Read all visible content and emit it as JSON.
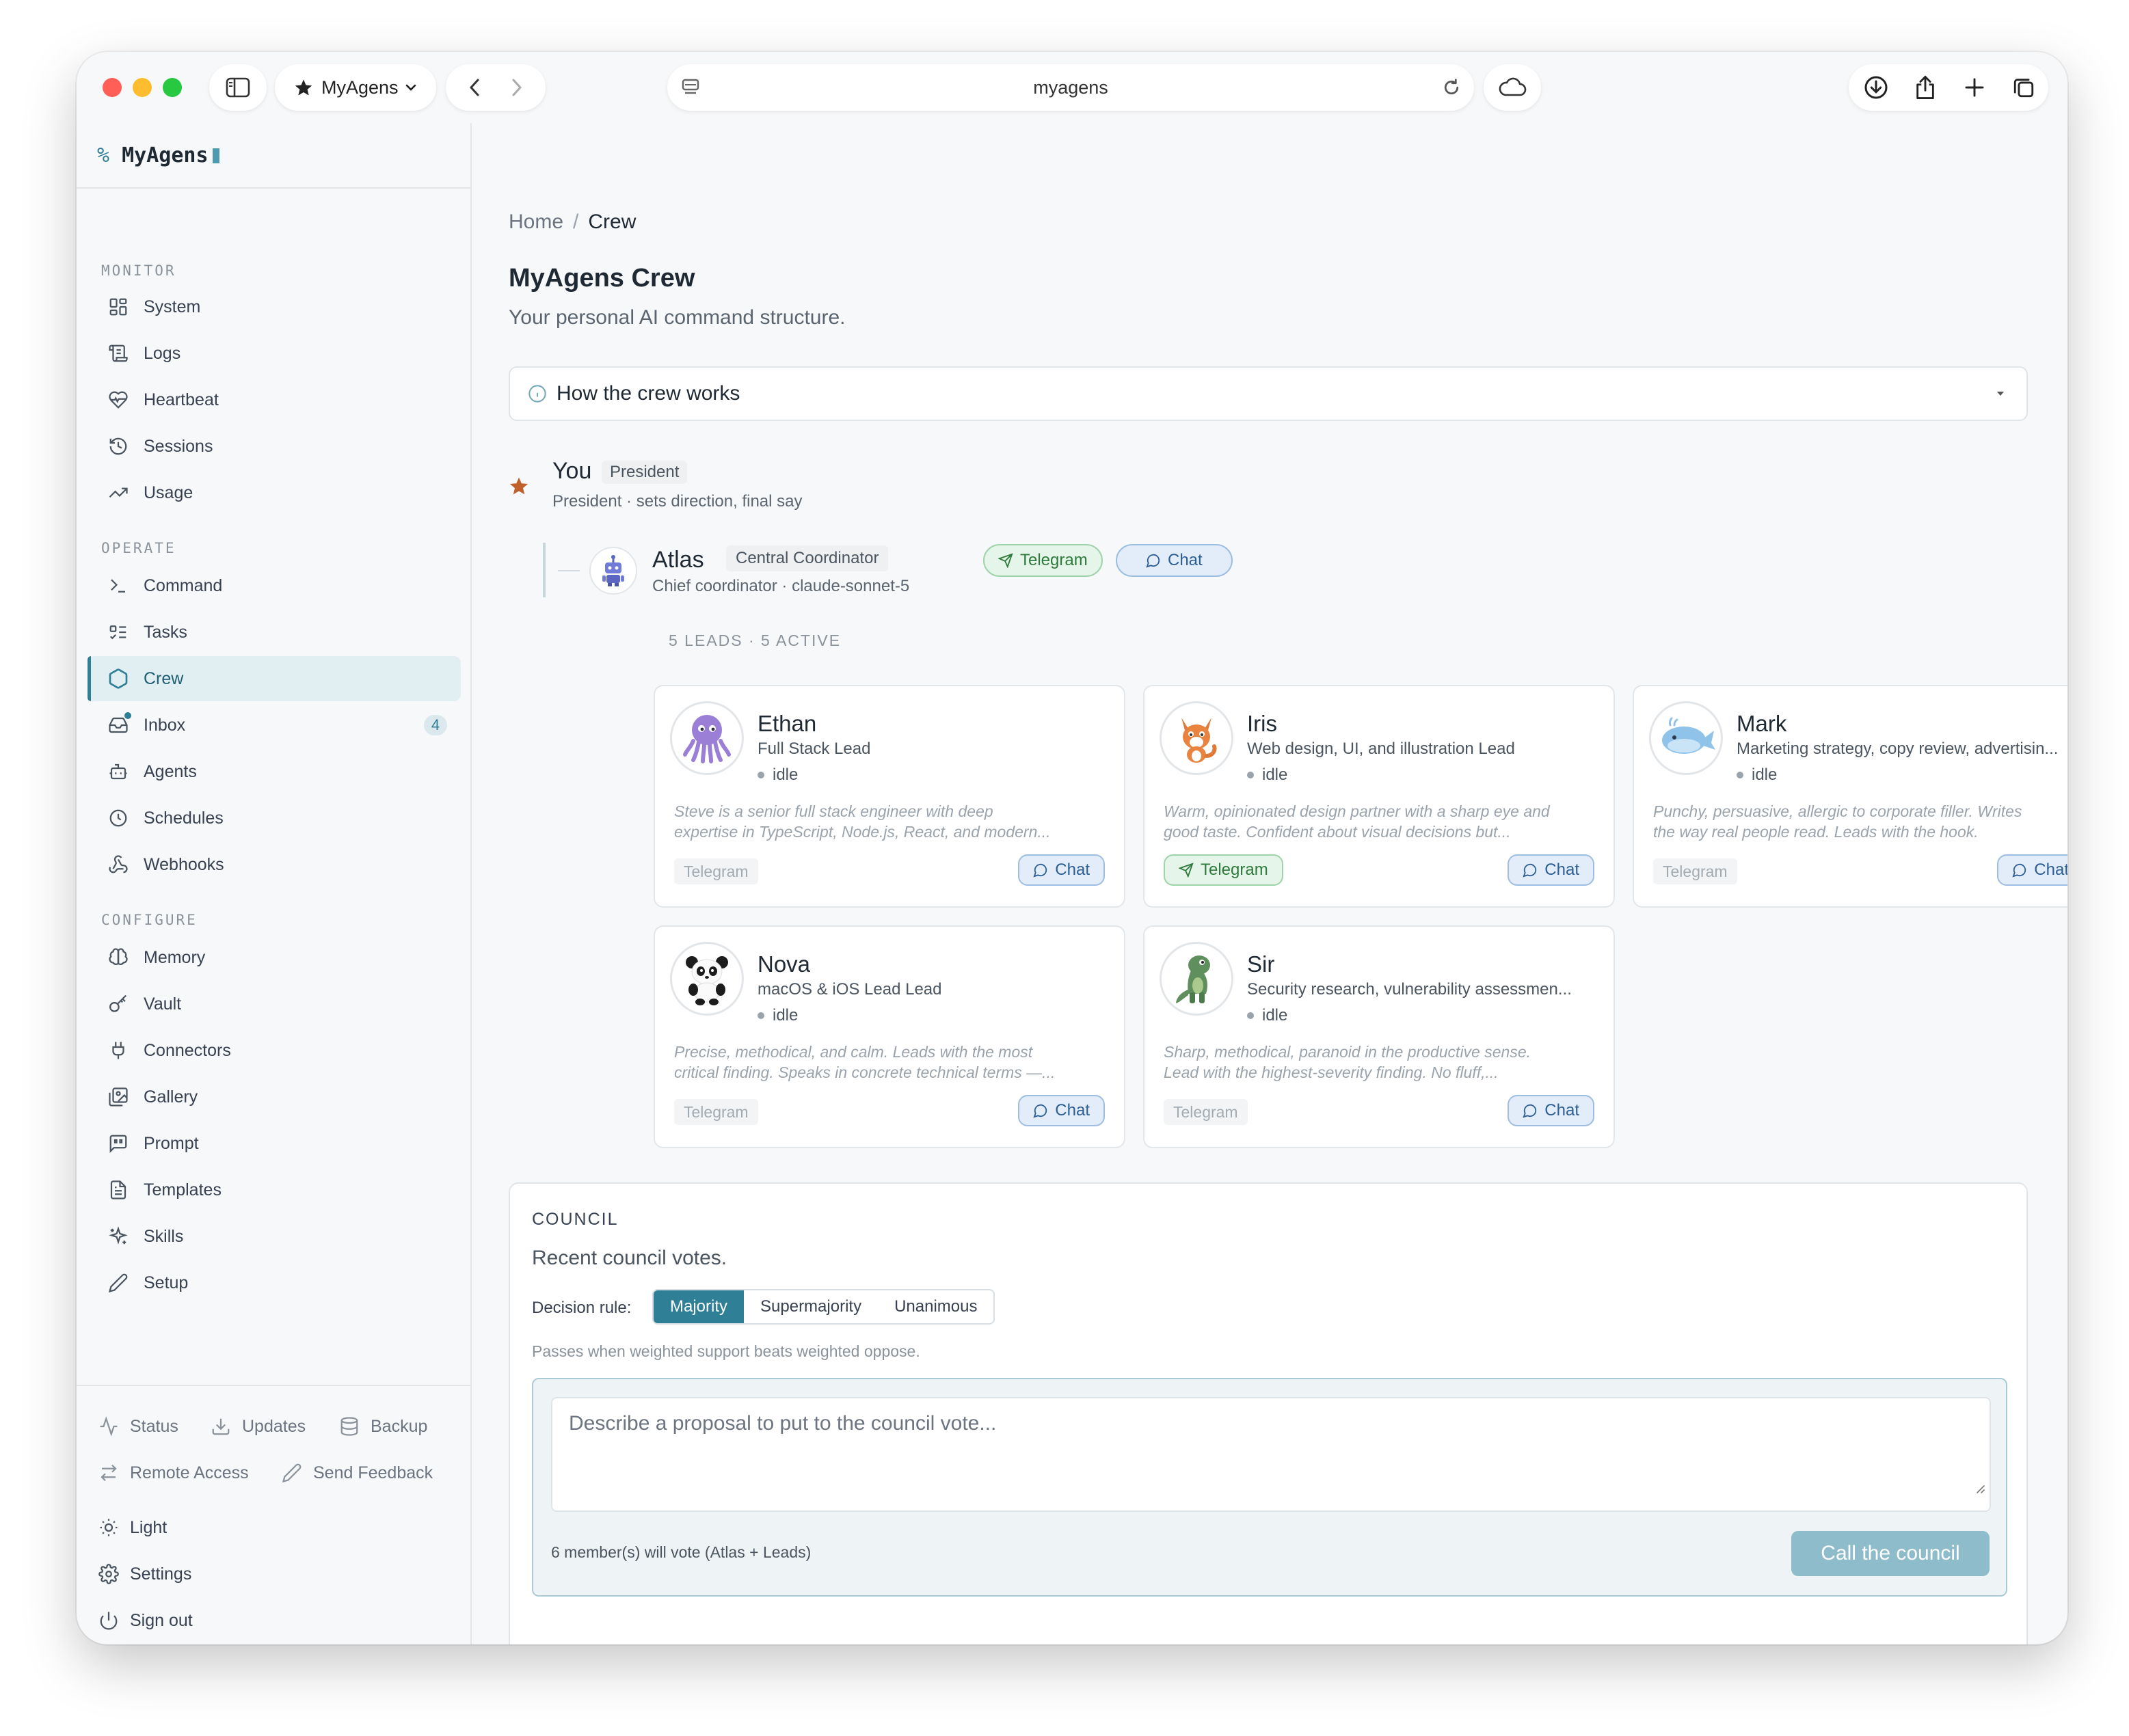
{
  "browser": {
    "tab_title": "MyAgens",
    "url": "myagens"
  },
  "sidebar": {
    "brand_prefix": "%",
    "brand": "MyAgens",
    "sections": {
      "monitor": "MONITOR",
      "operate": "OPERATE",
      "configure": "CONFIGURE"
    },
    "monitor_items": [
      "System",
      "Logs",
      "Heartbeat",
      "Sessions",
      "Usage"
    ],
    "operate_items": [
      "Command",
      "Tasks",
      "Crew",
      "Inbox",
      "Agents",
      "Schedules",
      "Webhooks"
    ],
    "configure_items": [
      "Memory",
      "Vault",
      "Connectors",
      "Gallery",
      "Prompt",
      "Templates",
      "Skills",
      "Setup"
    ],
    "inbox_badge": "4",
    "active_item": "Crew",
    "footer": {
      "status": "Status",
      "updates": "Updates",
      "backup": "Backup",
      "remote_access": "Remote Access",
      "send_feedback": "Send Feedback",
      "light": "Light",
      "settings": "Settings",
      "sign_out": "Sign out"
    }
  },
  "main": {
    "breadcrumb": {
      "home": "Home",
      "separator": "/",
      "current": "Crew"
    },
    "title": "MyAgens Crew",
    "subtitle": "Your personal AI command structure.",
    "how_it_works": "How the crew works",
    "president": {
      "name": "You",
      "tag": "President",
      "desc": "President · sets direction, final say"
    },
    "coordinator": {
      "name": "Atlas",
      "tag": "Central Coordinator",
      "telegram": "Telegram",
      "chat": "Chat",
      "desc": "Chief coordinator · claude-sonnet-5"
    },
    "leads_summary": "5 LEADS · 5 ACTIVE",
    "leads": [
      {
        "name": "Ethan",
        "role": "Full Stack Lead",
        "status": "idle",
        "desc1": "Steve is a senior full stack engineer with deep",
        "desc2": "expertise in TypeScript, Node.js, React, and modern...",
        "telegram": "Telegram",
        "chat": "Chat",
        "avatar": "octopus-icon"
      },
      {
        "name": "Iris",
        "role": "Web design, UI, and illustration Lead",
        "status": "idle",
        "desc1": "Warm, opinionated design partner with a sharp eye and",
        "desc2": "good taste. Confident about visual decisions but...",
        "telegram": "Telegram",
        "chat": "Chat",
        "avatar": "fox-icon"
      },
      {
        "name": "Mark",
        "role": "Marketing strategy, copy review, advertisin...",
        "status": "idle",
        "desc1": "Punchy, persuasive, allergic to corporate filler. Writes",
        "desc2": "the way real people read. Leads with the hook.",
        "telegram": "Telegram",
        "chat": "Chat",
        "avatar": "whale-icon"
      },
      {
        "name": "Nova",
        "role": "macOS & iOS Lead Lead",
        "status": "idle",
        "desc1": "Precise, methodical, and calm. Leads with the most",
        "desc2": "critical finding. Speaks in concrete technical terms —...",
        "telegram": "Telegram",
        "chat": "Chat",
        "avatar": "panda-icon"
      },
      {
        "name": "Sir",
        "role": "Security research, vulnerability assessmen...",
        "status": "idle",
        "desc1": "Sharp, methodical, paranoid in the productive sense.",
        "desc2": "Lead with the highest-severity finding. No fluff,...",
        "telegram": "Telegram",
        "chat": "Chat",
        "avatar": "dinosaur-icon"
      }
    ],
    "council": {
      "heading": "COUNCIL",
      "subtitle": "Recent council votes.",
      "rule_label": "Decision rule:",
      "rules": [
        "Majority",
        "Supermajority",
        "Unanimous"
      ],
      "selected_rule": "Majority",
      "rule_help": "Passes when weighted support beats weighted oppose.",
      "placeholder": "Describe a proposal to put to the council vote...",
      "value": "",
      "member_count": "6 member(s) will vote (Atlas + Leads)",
      "button": "Call the council"
    }
  },
  "colors": {
    "accent": "#2f7f97",
    "telegram_green": "#2d7a3c",
    "chat_blue": "#2c5e96",
    "star_orange": "#c2602c"
  }
}
